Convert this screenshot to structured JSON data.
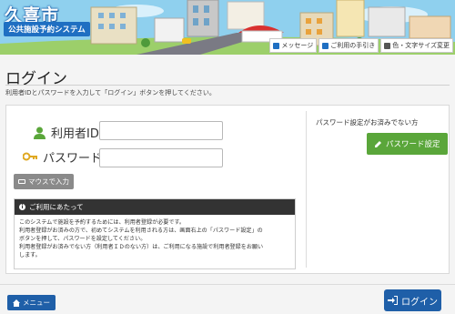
{
  "header": {
    "city_name": "久喜市",
    "system_name": "公共施設予約システム",
    "links": [
      {
        "label": "メッセージ",
        "icon": "chat-icon"
      },
      {
        "label": "ご利用の手引き",
        "icon": "book-icon"
      },
      {
        "label": "色・文字サイズ変更",
        "icon": "pencil-icon"
      }
    ]
  },
  "page": {
    "title": "ログイン",
    "instruction": "利用者IDとパスワードを入力して「ログイン」ボタンを押してください。"
  },
  "form": {
    "user_id_label": "利用者ID",
    "user_id_value": "",
    "password_label": "パスワード",
    "password_value": "",
    "keyboard_button": "マウスで入力"
  },
  "notice": {
    "heading": "ご利用にあたって",
    "lines": [
      "このシステムで施設を予約するためには、利用者登録が必要です。",
      "利用者登録がお済みの方で、初めてシステムを利用される方は、画面右上の「パスワード設定」の",
      "ボタンを押して、パスワードを設定してください。",
      "利用者登録がお済みでない方（利用者ＩＤのない方）は、ご利用になる施設で利用者登録をお願い",
      "します。"
    ]
  },
  "password_setup": {
    "note": "パスワード設定がお済みでない方",
    "button": "パスワード設定"
  },
  "footer": {
    "menu_button": "メニュー",
    "login_button": "ログイン"
  },
  "colors": {
    "primary_blue": "#1f5fa8",
    "green": "#5aa63a",
    "notice_header": "#333333"
  }
}
